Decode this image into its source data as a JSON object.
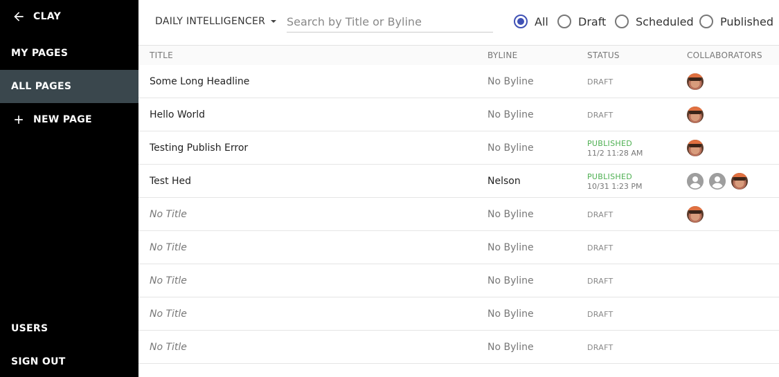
{
  "sidebar": {
    "app_name": "CLAY",
    "items": [
      {
        "label": "MY PAGES"
      },
      {
        "label": "ALL PAGES"
      },
      {
        "label": "NEW PAGE"
      },
      {
        "label": "USERS"
      },
      {
        "label": "SIGN OUT"
      }
    ]
  },
  "toolbar": {
    "site": "DAILY INTELLIGENCER",
    "search_placeholder": "Search by Title or Byline",
    "filters": [
      {
        "label": "All",
        "checked": true
      },
      {
        "label": "Draft",
        "checked": false
      },
      {
        "label": "Scheduled",
        "checked": false
      },
      {
        "label": "Published",
        "checked": false
      }
    ],
    "accent_color": "#3f51b5"
  },
  "table": {
    "headers": {
      "title": "TITLE",
      "byline": "BYLINE",
      "status": "STATUS",
      "collaborators": "COLLABORATORS"
    },
    "rows": [
      {
        "title": "Some Long Headline",
        "byline": "No Byline",
        "status": "DRAFT",
        "time": "",
        "collaborators": [
          "photo"
        ]
      },
      {
        "title": "Hello World",
        "byline": "No Byline",
        "status": "DRAFT",
        "time": "",
        "collaborators": [
          "photo"
        ]
      },
      {
        "title": "Testing Publish Error",
        "byline": "No Byline",
        "status": "PUBLISHED",
        "time": "11/2 11:28 AM",
        "collaborators": [
          "photo"
        ]
      },
      {
        "title": "Test Hed",
        "byline": "Nelson",
        "status": "PUBLISHED",
        "time": "10/31 1:23 PM",
        "collaborators": [
          "generic",
          "generic",
          "photo"
        ]
      },
      {
        "title": "No Title",
        "byline": "No Byline",
        "status": "DRAFT",
        "time": "",
        "collaborators": [
          "photo"
        ]
      },
      {
        "title": "No Title",
        "byline": "No Byline",
        "status": "DRAFT",
        "time": "",
        "collaborators": []
      },
      {
        "title": "No Title",
        "byline": "No Byline",
        "status": "DRAFT",
        "time": "",
        "collaborators": []
      },
      {
        "title": "No Title",
        "byline": "No Byline",
        "status": "DRAFT",
        "time": "",
        "collaborators": []
      },
      {
        "title": "No Title",
        "byline": "No Byline",
        "status": "DRAFT",
        "time": "",
        "collaborators": []
      }
    ],
    "published_color": "#4caf50"
  }
}
